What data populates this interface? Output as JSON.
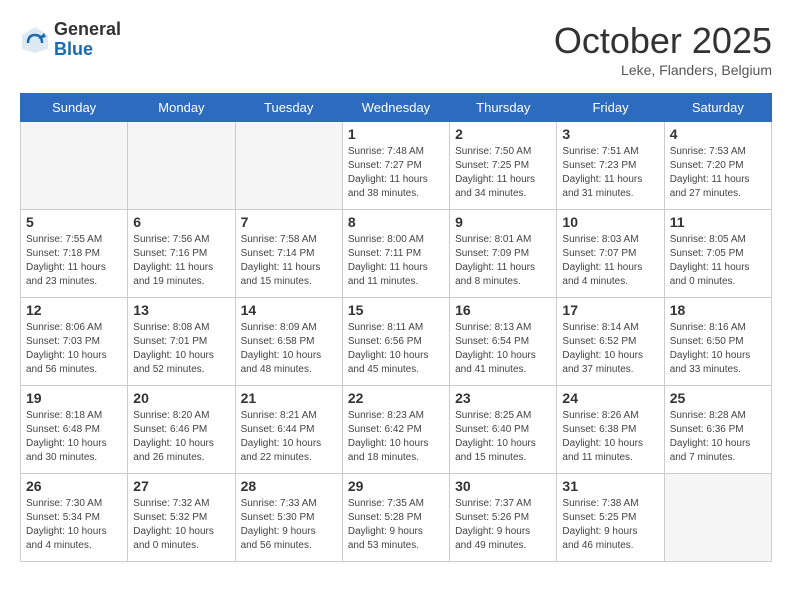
{
  "header": {
    "logo_general": "General",
    "logo_blue": "Blue",
    "month": "October 2025",
    "location": "Leke, Flanders, Belgium"
  },
  "weekdays": [
    "Sunday",
    "Monday",
    "Tuesday",
    "Wednesday",
    "Thursday",
    "Friday",
    "Saturday"
  ],
  "weeks": [
    [
      {
        "day": "",
        "info": ""
      },
      {
        "day": "",
        "info": ""
      },
      {
        "day": "",
        "info": ""
      },
      {
        "day": "1",
        "info": "Sunrise: 7:48 AM\nSunset: 7:27 PM\nDaylight: 11 hours\nand 38 minutes."
      },
      {
        "day": "2",
        "info": "Sunrise: 7:50 AM\nSunset: 7:25 PM\nDaylight: 11 hours\nand 34 minutes."
      },
      {
        "day": "3",
        "info": "Sunrise: 7:51 AM\nSunset: 7:23 PM\nDaylight: 11 hours\nand 31 minutes."
      },
      {
        "day": "4",
        "info": "Sunrise: 7:53 AM\nSunset: 7:20 PM\nDaylight: 11 hours\nand 27 minutes."
      }
    ],
    [
      {
        "day": "5",
        "info": "Sunrise: 7:55 AM\nSunset: 7:18 PM\nDaylight: 11 hours\nand 23 minutes."
      },
      {
        "day": "6",
        "info": "Sunrise: 7:56 AM\nSunset: 7:16 PM\nDaylight: 11 hours\nand 19 minutes."
      },
      {
        "day": "7",
        "info": "Sunrise: 7:58 AM\nSunset: 7:14 PM\nDaylight: 11 hours\nand 15 minutes."
      },
      {
        "day": "8",
        "info": "Sunrise: 8:00 AM\nSunset: 7:11 PM\nDaylight: 11 hours\nand 11 minutes."
      },
      {
        "day": "9",
        "info": "Sunrise: 8:01 AM\nSunset: 7:09 PM\nDaylight: 11 hours\nand 8 minutes."
      },
      {
        "day": "10",
        "info": "Sunrise: 8:03 AM\nSunset: 7:07 PM\nDaylight: 11 hours\nand 4 minutes."
      },
      {
        "day": "11",
        "info": "Sunrise: 8:05 AM\nSunset: 7:05 PM\nDaylight: 11 hours\nand 0 minutes."
      }
    ],
    [
      {
        "day": "12",
        "info": "Sunrise: 8:06 AM\nSunset: 7:03 PM\nDaylight: 10 hours\nand 56 minutes."
      },
      {
        "day": "13",
        "info": "Sunrise: 8:08 AM\nSunset: 7:01 PM\nDaylight: 10 hours\nand 52 minutes."
      },
      {
        "day": "14",
        "info": "Sunrise: 8:09 AM\nSunset: 6:58 PM\nDaylight: 10 hours\nand 48 minutes."
      },
      {
        "day": "15",
        "info": "Sunrise: 8:11 AM\nSunset: 6:56 PM\nDaylight: 10 hours\nand 45 minutes."
      },
      {
        "day": "16",
        "info": "Sunrise: 8:13 AM\nSunset: 6:54 PM\nDaylight: 10 hours\nand 41 minutes."
      },
      {
        "day": "17",
        "info": "Sunrise: 8:14 AM\nSunset: 6:52 PM\nDaylight: 10 hours\nand 37 minutes."
      },
      {
        "day": "18",
        "info": "Sunrise: 8:16 AM\nSunset: 6:50 PM\nDaylight: 10 hours\nand 33 minutes."
      }
    ],
    [
      {
        "day": "19",
        "info": "Sunrise: 8:18 AM\nSunset: 6:48 PM\nDaylight: 10 hours\nand 30 minutes."
      },
      {
        "day": "20",
        "info": "Sunrise: 8:20 AM\nSunset: 6:46 PM\nDaylight: 10 hours\nand 26 minutes."
      },
      {
        "day": "21",
        "info": "Sunrise: 8:21 AM\nSunset: 6:44 PM\nDaylight: 10 hours\nand 22 minutes."
      },
      {
        "day": "22",
        "info": "Sunrise: 8:23 AM\nSunset: 6:42 PM\nDaylight: 10 hours\nand 18 minutes."
      },
      {
        "day": "23",
        "info": "Sunrise: 8:25 AM\nSunset: 6:40 PM\nDaylight: 10 hours\nand 15 minutes."
      },
      {
        "day": "24",
        "info": "Sunrise: 8:26 AM\nSunset: 6:38 PM\nDaylight: 10 hours\nand 11 minutes."
      },
      {
        "day": "25",
        "info": "Sunrise: 8:28 AM\nSunset: 6:36 PM\nDaylight: 10 hours\nand 7 minutes."
      }
    ],
    [
      {
        "day": "26",
        "info": "Sunrise: 7:30 AM\nSunset: 5:34 PM\nDaylight: 10 hours\nand 4 minutes."
      },
      {
        "day": "27",
        "info": "Sunrise: 7:32 AM\nSunset: 5:32 PM\nDaylight: 10 hours\nand 0 minutes."
      },
      {
        "day": "28",
        "info": "Sunrise: 7:33 AM\nSunset: 5:30 PM\nDaylight: 9 hours\nand 56 minutes."
      },
      {
        "day": "29",
        "info": "Sunrise: 7:35 AM\nSunset: 5:28 PM\nDaylight: 9 hours\nand 53 minutes."
      },
      {
        "day": "30",
        "info": "Sunrise: 7:37 AM\nSunset: 5:26 PM\nDaylight: 9 hours\nand 49 minutes."
      },
      {
        "day": "31",
        "info": "Sunrise: 7:38 AM\nSunset: 5:25 PM\nDaylight: 9 hours\nand 46 minutes."
      },
      {
        "day": "",
        "info": ""
      }
    ]
  ]
}
